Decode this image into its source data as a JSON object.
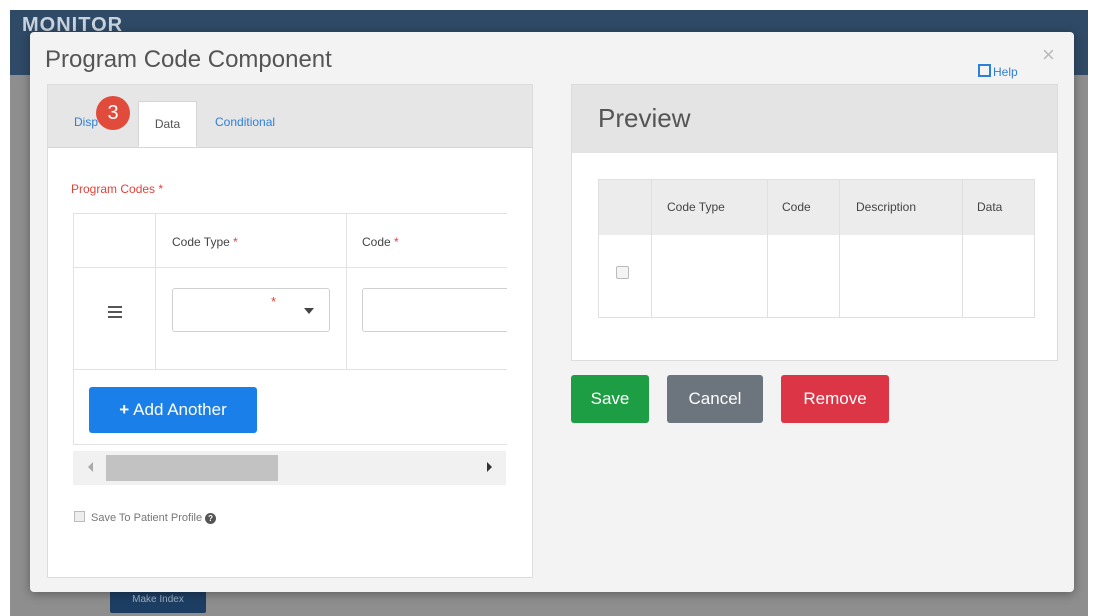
{
  "background": {
    "brand": "MONITOR",
    "main_button": "Make Index"
  },
  "modal": {
    "title": "Program Code Component",
    "help_label": "Help",
    "close_glyph": "×"
  },
  "tabs": [
    {
      "label": "Disp"
    },
    {
      "label": "Data"
    },
    {
      "label": "Conditional"
    }
  ],
  "step_badge": "3",
  "form": {
    "program_codes_label": "Program Codes *",
    "columns": [
      {
        "label": "Code Type",
        "required": "*"
      },
      {
        "label": "Code",
        "required": "*"
      }
    ],
    "row": {
      "code_type_value": "",
      "code_value": ""
    },
    "add_button": "Add Another",
    "add_plus": "+",
    "save_to_profile_label": "Save To Patient Profile"
  },
  "preview": {
    "title": "Preview",
    "columns": [
      "Code Type",
      "Code",
      "Description",
      "Data"
    ]
  },
  "actions": {
    "save": "Save",
    "cancel": "Cancel",
    "remove": "Remove"
  },
  "colors": {
    "primary": "#1a7fe8",
    "success": "#1e9e44",
    "secondary": "#6c757d",
    "danger": "#dc3545",
    "required": "#e0433a",
    "header_bg": "#2f4a66"
  }
}
